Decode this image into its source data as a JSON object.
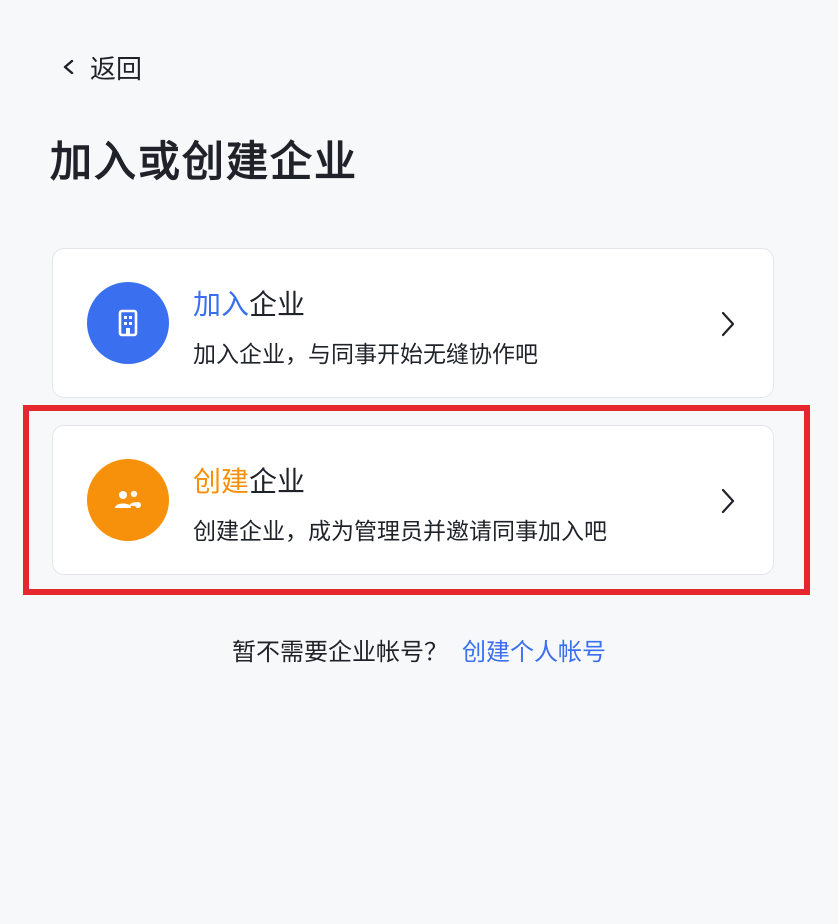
{
  "nav": {
    "back_label": "返回"
  },
  "page": {
    "title": "加入或创建企业"
  },
  "options": [
    {
      "title_accent": "加入",
      "title_rest": "企业",
      "description": "加入企业，与同事开始无缝协作吧",
      "icon": "building-icon",
      "accent_color": "#3a6ff0"
    },
    {
      "title_accent": "创建",
      "title_rest": "企业",
      "description": "创建企业，成为管理员并邀请同事加入吧",
      "icon": "group-icon",
      "accent_color": "#f7900a"
    }
  ],
  "footer": {
    "question": "暂不需要企业帐号？",
    "link_label": "创建个人帐号"
  },
  "colors": {
    "link": "#3a6ff0",
    "highlight": "#e8262d",
    "background": "#f7f8fa"
  }
}
